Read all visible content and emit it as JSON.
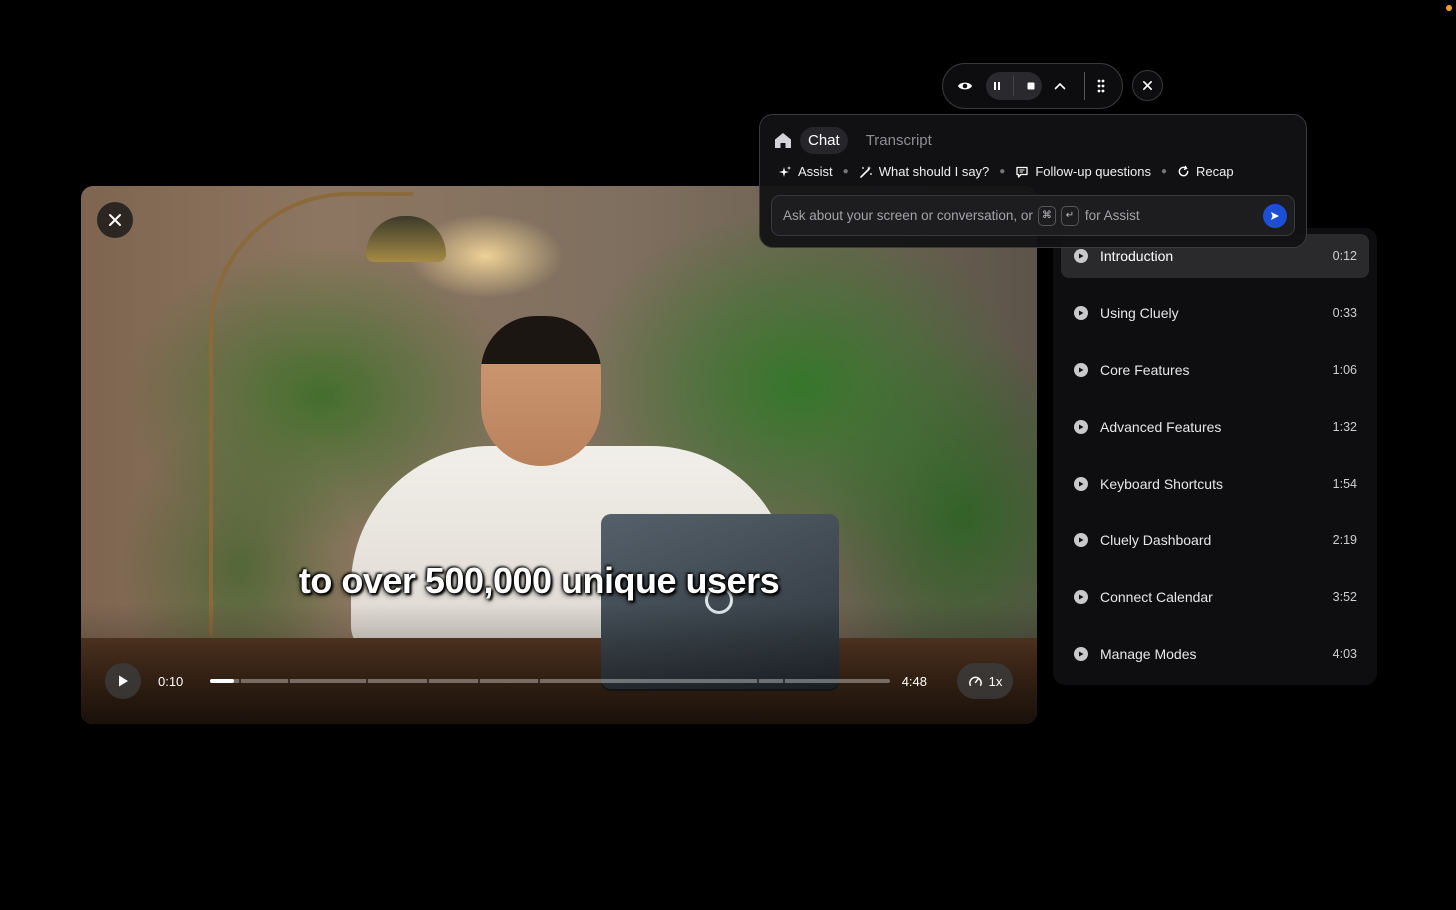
{
  "video": {
    "caption": "to over 500,000 unique users",
    "current_time": "0:10",
    "duration": "4:48",
    "speed_label": "1x",
    "progress": 0.035
  },
  "chapters": [
    {
      "label": "Introduction",
      "time": "0:12",
      "active": true
    },
    {
      "label": "Using Cluely",
      "time": "0:33"
    },
    {
      "label": "Core Features",
      "time": "1:06"
    },
    {
      "label": "Advanced Features",
      "time": "1:32"
    },
    {
      "label": "Keyboard Shortcuts",
      "time": "1:54"
    },
    {
      "label": "Cluely Dashboard",
      "time": "2:19"
    },
    {
      "label": "Connect Calendar",
      "time": "3:52"
    },
    {
      "label": "Manage Modes",
      "time": "4:03"
    }
  ],
  "chat": {
    "tabs": {
      "chat": "Chat",
      "transcript": "Transcript"
    },
    "actions": {
      "assist": "Assist",
      "what_say": "What should I say?",
      "followup": "Follow-up questions",
      "recap": "Recap"
    },
    "input": {
      "prefix": "Ask about your screen or conversation, or",
      "key1": "⌘",
      "key2": "↵",
      "suffix": "for Assist"
    }
  },
  "colors": {
    "accent": "#1d4fd6",
    "status_dot": "#ff9f1a"
  }
}
